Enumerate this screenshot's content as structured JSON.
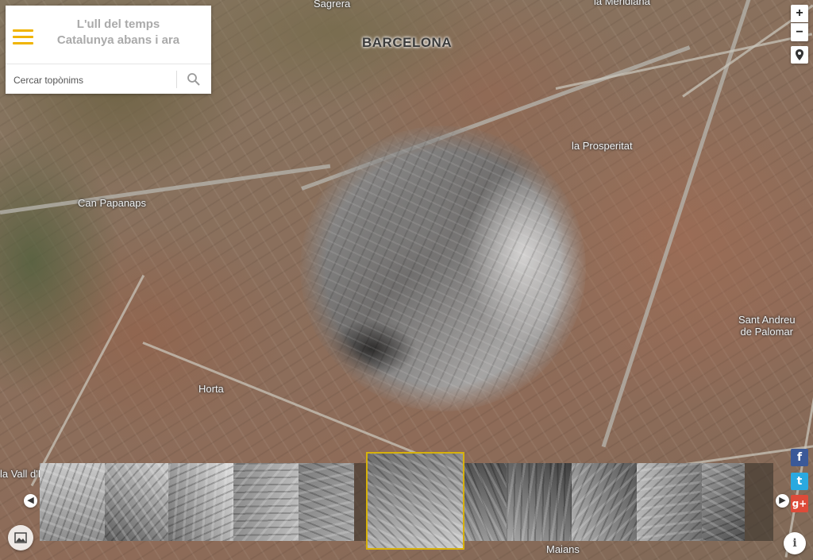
{
  "app": {
    "title_line1": "L'ull del temps",
    "title_line2": "Catalunya abans i ara"
  },
  "search": {
    "placeholder": "Cercar topònims"
  },
  "map_controls": {
    "zoom_in": "+",
    "zoom_out": "−",
    "locate_icon": "map-marker-icon"
  },
  "map_labels": {
    "barcelona": "BARCELONA",
    "sagrera": "Sagrera",
    "la_prosperitat": "la Prosperitat",
    "can_papanaps": "Can Papanaps",
    "sant_andreu_line1": "Sant Andreu",
    "sant_andreu_line2": "de Palomar",
    "horta": "Horta",
    "vall_hebron": "la Vall d'Hebron",
    "meridiana": "la Meridiana",
    "maians": "Maians"
  },
  "social": {
    "facebook": "f",
    "twitter": "t",
    "googleplus": "g+"
  },
  "filmstrip": {
    "prev_icon": "chevron-left-icon",
    "next_icon": "chevron-right-icon",
    "thumbnails": [
      {
        "tone": "#8e8e8e",
        "accent": "#c9c9c9",
        "selected": false
      },
      {
        "tone": "#5f5f5f",
        "accent": "#d0d0d0",
        "selected": false
      },
      {
        "tone": "#707070",
        "accent": "#e0e0e0",
        "selected": false
      },
      {
        "tone": "#8a8a8a",
        "accent": "#bdbdbd",
        "selected": false
      },
      {
        "tone": "#7c7c7c",
        "accent": "#aaaaaa",
        "selected": false
      },
      {
        "tone": "#6a6a6a",
        "accent": "#cfcfcf",
        "selected": true
      },
      {
        "tone": "#4e4e4e",
        "accent": "#9a9a9a",
        "selected": false
      },
      {
        "tone": "#3f3f3f",
        "accent": "#a6a6a6",
        "selected": false
      },
      {
        "tone": "#575757",
        "accent": "#b4b4b4",
        "selected": false
      },
      {
        "tone": "#6b6b6b",
        "accent": "#c0c0c0",
        "selected": false
      },
      {
        "tone": "#505050",
        "accent": "#9c9c9c",
        "selected": false
      }
    ]
  },
  "colors": {
    "menu_accent": "#f0b400",
    "selected_thumb_border": "#d7b10b",
    "facebook": "#3b5998",
    "twitter": "#2aa9e0",
    "googleplus": "#dd4b39"
  },
  "info_icon": "i"
}
